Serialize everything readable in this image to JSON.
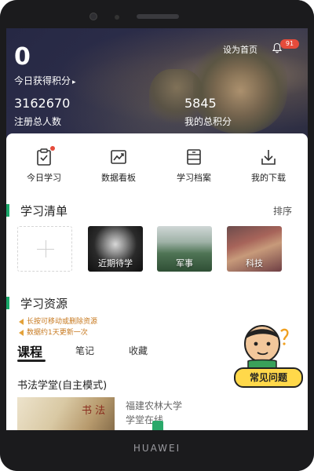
{
  "device": {
    "brand": "HUAWEI"
  },
  "header": {
    "score_value": "0",
    "score_label": "今日获得积分",
    "score_caret": "▸",
    "set_home_label": "设为首页",
    "notification_count": "91",
    "registered_users_value": "3162670",
    "registered_users_label": "注册总人数",
    "total_points_value": "5845",
    "total_points_label": "我的总积分"
  },
  "quick_actions": [
    {
      "label": "今日学习",
      "icon": "clipboard-check-icon",
      "has_dot": true
    },
    {
      "label": "数据看板",
      "icon": "chart-board-icon",
      "has_dot": false
    },
    {
      "label": "学习档案",
      "icon": "archive-icon",
      "has_dot": false
    },
    {
      "label": "我的下载",
      "icon": "download-icon",
      "has_dot": false
    }
  ],
  "study_list": {
    "title": "学习清单",
    "sort_label": "排序",
    "tiles": [
      {
        "label": "近期待学"
      },
      {
        "label": "军事"
      },
      {
        "label": "科技"
      }
    ]
  },
  "resources": {
    "title": "学习资源",
    "tips": [
      "长按可移动或删除资源",
      "数据约1天更新一次"
    ],
    "tabs": [
      "课程",
      "笔记",
      "收藏"
    ],
    "active_tab": "课程"
  },
  "course": {
    "title": "书法学堂(自主模式)",
    "institution": "福建农林大学",
    "subtitle": "学堂在线"
  },
  "faq": {
    "label": "常见问题"
  },
  "colors": {
    "accent_green": "#1aa86a",
    "badge_red": "#e54b3b",
    "faq_yellow": "#ffd84a",
    "tip_orange": "#c7791f"
  }
}
